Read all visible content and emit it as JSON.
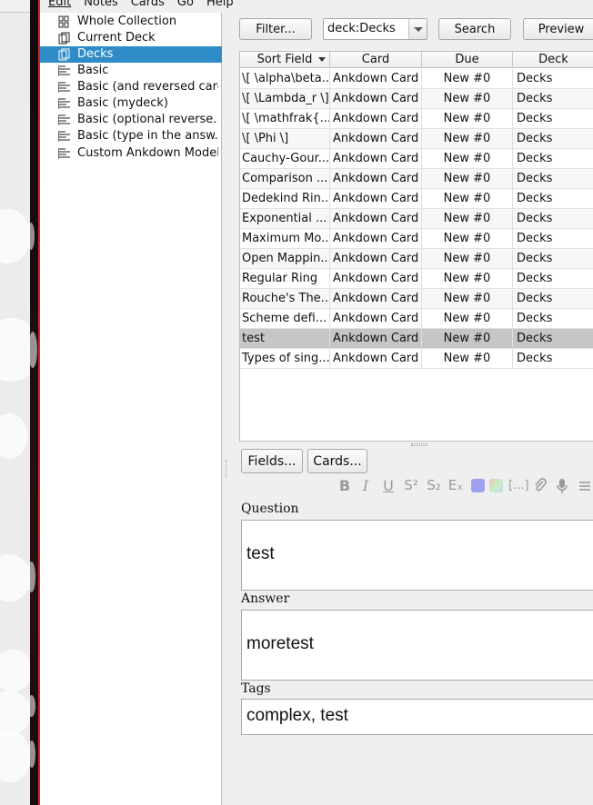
{
  "menubar": {
    "items": [
      "Edit",
      "Notes",
      "Cards",
      "Go",
      "Help"
    ]
  },
  "sidebar": {
    "items": [
      {
        "label": "Whole Collection",
        "icon": "collection-icon"
      },
      {
        "label": "Current Deck",
        "icon": "deck-icon"
      },
      {
        "label": "Decks",
        "icon": "deck-icon",
        "selected": true
      },
      {
        "label": "Basic",
        "icon": "note-type-icon"
      },
      {
        "label": "Basic (and reversed card)",
        "icon": "note-type-icon"
      },
      {
        "label": "Basic (mydeck)",
        "icon": "note-type-icon"
      },
      {
        "label": "Basic (optional reverse...",
        "icon": "note-type-icon"
      },
      {
        "label": "Basic (type in the answ...",
        "icon": "note-type-icon"
      },
      {
        "label": "Custom Ankdown Model",
        "icon": "note-type-icon"
      }
    ]
  },
  "toolbar": {
    "filter_label": "Filter...",
    "search_value": "deck:Decks",
    "search_label": "Search",
    "preview_label": "Preview"
  },
  "table": {
    "columns": [
      "Sort Field",
      "Card",
      "Due",
      "Deck"
    ],
    "rows": [
      [
        "\\[ \\alpha\\beta...",
        "Ankdown Card",
        "New #0",
        "Decks"
      ],
      [
        "\\[ \\Lambda_r \\]",
        "Ankdown Card",
        "New #0",
        "Decks"
      ],
      [
        "\\[ \\mathfrak{...",
        "Ankdown Card",
        "New #0",
        "Decks"
      ],
      [
        "\\[ \\Phi \\]",
        "Ankdown Card",
        "New #0",
        "Decks"
      ],
      [
        "Cauchy-Gour...",
        "Ankdown Card",
        "New #0",
        "Decks"
      ],
      [
        "Comparison ...",
        "Ankdown Card",
        "New #0",
        "Decks"
      ],
      [
        "Dedekind Rin...",
        "Ankdown Card",
        "New #0",
        "Decks"
      ],
      [
        "Exponential ...",
        "Ankdown Card",
        "New #0",
        "Decks"
      ],
      [
        "Maximum Mo...",
        "Ankdown Card",
        "New #0",
        "Decks"
      ],
      [
        "Open Mappin...",
        "Ankdown Card",
        "New #0",
        "Decks"
      ],
      [
        "Regular Ring",
        "Ankdown Card",
        "New #0",
        "Decks"
      ],
      [
        "Rouche's The...",
        "Ankdown Card",
        "New #0",
        "Decks"
      ],
      [
        "Scheme defi...",
        "Ankdown Card",
        "New #0",
        "Decks"
      ],
      [
        "test",
        "Ankdown Card",
        "New #0",
        "Decks"
      ],
      [
        "Types of sing...",
        "Ankdown Card",
        "New #0",
        "Decks"
      ]
    ],
    "selected_row": 13
  },
  "editor": {
    "fields_button": "Fields...",
    "cards_button": "Cards...",
    "format_buttons": [
      "B",
      "I",
      "U",
      "S²",
      "S₂",
      "Eₓ",
      "text-color-icon",
      "highlight-color-icon",
      "[...]",
      "attach-icon",
      "record-icon",
      "more-icon"
    ],
    "fields": [
      {
        "label": "Question",
        "value": "test"
      },
      {
        "label": "Answer",
        "value": "moretest"
      }
    ],
    "tags_label": "Tags",
    "tags_value": "complex, test"
  }
}
